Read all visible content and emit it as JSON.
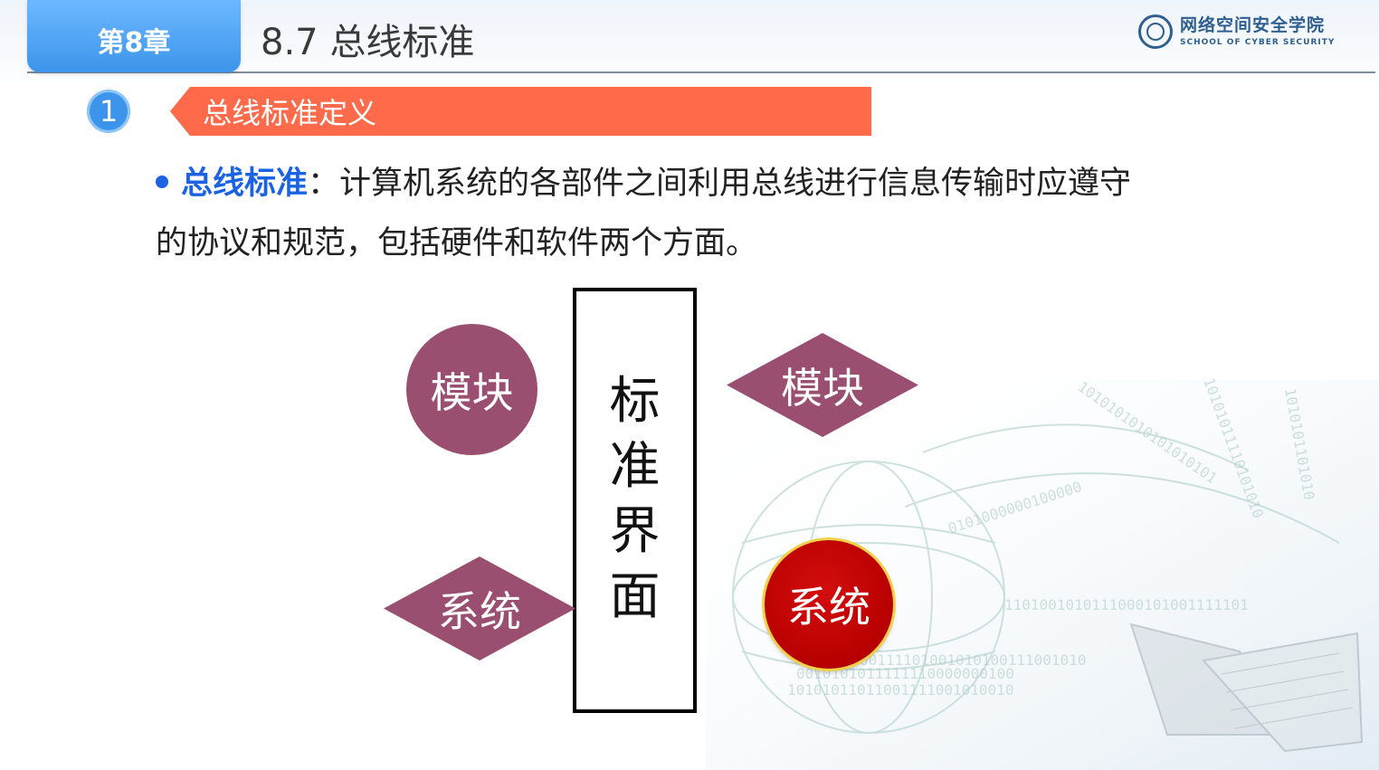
{
  "header": {
    "chapter_label": "第8章",
    "title": "8.7 总线标准",
    "logo": {
      "cn": "网络空间安全学院",
      "en": "SCHOOL OF CYBER SECURITY"
    }
  },
  "section": {
    "number": "1",
    "heading": "总线标准定义"
  },
  "definition": {
    "term": "总线标准",
    "separator": "：",
    "text_line1": "计算机系统的各部件之间利用总线进行信息传输时应遵守",
    "text_line2": "的协议和规范，包括硬件和软件两个方面。"
  },
  "diagram": {
    "interface_chars": [
      "标",
      "准",
      "界",
      "面"
    ],
    "module_circle": "模块",
    "module_diamond": "模块",
    "system_diamond": "系统",
    "system_circle": "系统"
  },
  "colors": {
    "accent_blue": "#3c95ea",
    "banner_orange": "#ff6a4a",
    "term_blue": "#1c63e3",
    "shape_purple": "#9a4f70",
    "system_red": "#b70000"
  }
}
